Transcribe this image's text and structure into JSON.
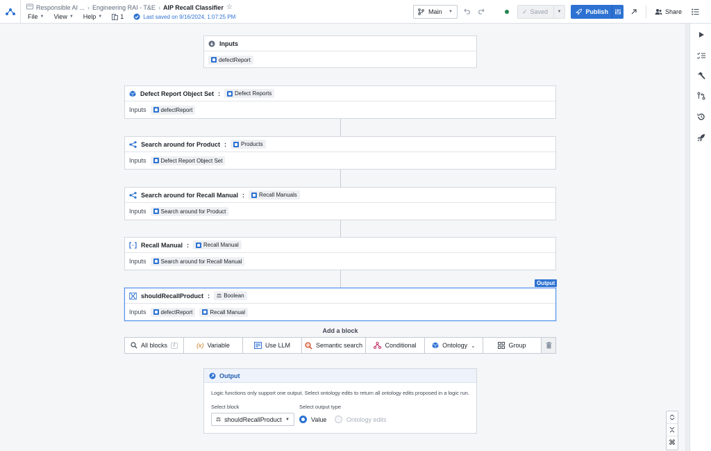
{
  "header": {
    "breadcrumbs": [
      "Responsible AI ...",
      "Engineering RAI - T&E"
    ],
    "title": "AIP Recall Classifier",
    "menus": [
      "File",
      "View",
      "Help"
    ],
    "version_count": "1",
    "saved_note": "Last saved on 9/16/2024, 1:07:25 PM",
    "branch": "Main",
    "saved_label": "Saved",
    "publish_label": "Publish",
    "share_label": "Share",
    "colors": {
      "primary": "#2d72d2",
      "status_ok": "#238551"
    }
  },
  "inputs_card": {
    "title": "Inputs",
    "param": "defectReport"
  },
  "blocks": [
    {
      "title": "Defect Report Object Set",
      "type": "Defect Reports",
      "inputs_label": "Inputs",
      "inputs": [
        "defectReport"
      ]
    },
    {
      "title": "Search around for Product",
      "type": "Products",
      "inputs_label": "Inputs",
      "inputs": [
        "Defect Report Object Set"
      ]
    },
    {
      "title": "Search around for Recall Manual",
      "type": "Recall Manuals",
      "inputs_label": "Inputs",
      "inputs": [
        "Search around for Product"
      ]
    },
    {
      "title": "Recall Manual",
      "type": "Recall Manual",
      "inputs_label": "Inputs",
      "inputs": [
        "Search around for Recall Manual"
      ]
    },
    {
      "title": "shouldRecallProduct",
      "type": "Boolean",
      "inputs_label": "Inputs",
      "inputs": [
        "defectReport",
        "Recall Manual"
      ],
      "badge": "Output"
    }
  ],
  "add_block": {
    "label": "Add a block",
    "buttons": [
      "All blocks",
      "Variable",
      "Use LLM",
      "Semantic search",
      "Conditional",
      "Ontology",
      "Group"
    ],
    "shortcut": "/"
  },
  "output_panel": {
    "title": "Output",
    "description": "Logic functions only support one output. Select ontology edits to return all ontology edits proposed in a logic run.",
    "select_block_label": "Select block",
    "selected_block": "shouldRecallProduct",
    "output_type_label": "Select output type",
    "options": [
      "Value",
      "Ontology edits"
    ],
    "selected_option": "Value"
  }
}
